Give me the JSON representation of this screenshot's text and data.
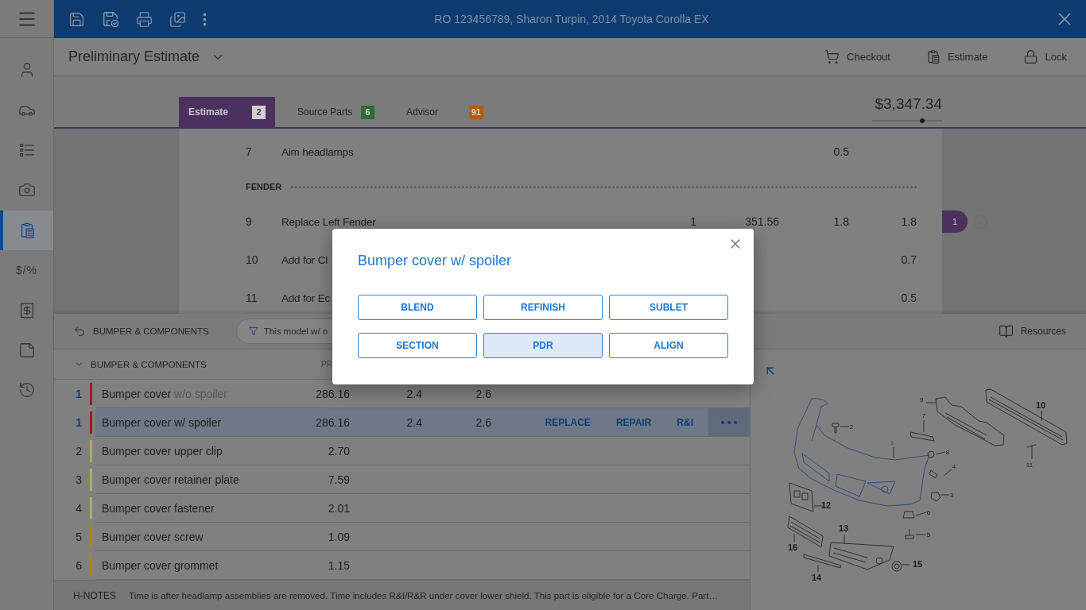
{
  "top_bar": {
    "title": "RO 123456789, Sharon Turpin, 2014 Toyota Corolla EX"
  },
  "sidebar": {
    "items": [
      {
        "selected": false
      },
      {
        "selected": false
      },
      {
        "selected": false
      },
      {
        "selected": false
      },
      {
        "selected": true
      },
      {
        "selected": false,
        "glyph": "$/%"
      },
      {
        "selected": false
      },
      {
        "selected": false
      },
      {
        "selected": false
      }
    ]
  },
  "header": {
    "title": "Preliminary Estimate",
    "actions": [
      "Checkout",
      "Estimate",
      "Lock"
    ]
  },
  "tabs": [
    {
      "label": "Estimate",
      "count": "2",
      "color": "#4a3160",
      "selected": true
    },
    {
      "label": "Source Parts",
      "count": "6",
      "color": "#2e6e31",
      "selected": false
    },
    {
      "label": "Advisor",
      "count": "91",
      "color": "#b35f00",
      "selected": false
    }
  ],
  "total": {
    "amount": "$3,347.34",
    "level": 0.72
  },
  "estimate_lines": [
    {
      "kind": "line",
      "number": "7",
      "description": "Aim headlamps",
      "column_5": "0.5"
    },
    {
      "kind": "section",
      "title": "FENDER"
    },
    {
      "kind": "line",
      "number": "9",
      "description": "Replace Left Fender",
      "column_3": "1",
      "column_4": "351.56",
      "column_5": "1.8",
      "column_6": "1.8",
      "badge": "1"
    },
    {
      "kind": "line",
      "number": "10",
      "description": "Add for Cl",
      "column_6": "0.7"
    },
    {
      "kind": "line",
      "number": "11",
      "description": "Add for Ec",
      "column_6": "0.5"
    }
  ],
  "parts_panel": {
    "breadcrumb": "BUMPER & COMPONENTS",
    "filter": "This model w/ o",
    "resources": "Resources",
    "group": {
      "title": "BUMPER & COMPONENTS",
      "expanded": true
    },
    "columns": [
      "PR"
    ],
    "rows": [
      {
        "quantity": "1",
        "emphasized": true,
        "color": "#9a1f1f",
        "name": "Bumper cover",
        "qualifier": "w/o spoiler",
        "column_2": "286.16",
        "column_3": "2.4",
        "column_4": "2.6",
        "selected": false
      },
      {
        "quantity": "1",
        "emphasized": true,
        "color": "#9a1f1f",
        "name": "Bumper cover w/ spoiler",
        "column_2": "286.16",
        "column_3": "2.4",
        "column_4": "2.6",
        "selected": true,
        "actions": [
          "REPLACE",
          "REPAIR",
          "R&I"
        ]
      },
      {
        "quantity": "2",
        "emphasized": false,
        "color": "#b3a95e",
        "name": "Bumper cover upper clip",
        "column_2": "2.70",
        "selected": false
      },
      {
        "quantity": "3",
        "emphasized": false,
        "color": "#b3a95e",
        "name": "Bumper cover retainer plate",
        "column_2": "7.59",
        "selected": false
      },
      {
        "quantity": "4",
        "emphasized": false,
        "color": "#b3a95e",
        "name": "Bumper cover fastener",
        "column_2": "2.01",
        "selected": false
      },
      {
        "quantity": "5",
        "emphasized": false,
        "color": "#a8870f",
        "name": "Bumper cover screw",
        "column_2": "1.09",
        "selected": false
      },
      {
        "quantity": "6",
        "emphasized": false,
        "color": "#a8870f",
        "name": "Bumper cover grommet",
        "column_2": "1.15",
        "selected": false
      }
    ],
    "notes": {
      "label": "H-NOTES",
      "text": "Time is after headlamp assemblies are removed. Time includes R&I/R&R under cover lower shield. This part is eligible for a Core Charge. Part…"
    }
  },
  "diagram": {
    "callouts": [
      {
        "label": "1",
        "highlighted": true
      },
      {
        "label": "2",
        "highlighted": false
      },
      {
        "label": "3",
        "highlighted": false
      },
      {
        "label": "4",
        "highlighted": false
      },
      {
        "label": "5",
        "highlighted": false
      },
      {
        "label": "6",
        "highlighted": false
      },
      {
        "label": "7",
        "highlighted": false
      },
      {
        "label": "8",
        "highlighted": false
      },
      {
        "label": "9",
        "highlighted": false
      },
      {
        "label": "10",
        "highlighted": false
      },
      {
        "label": "11",
        "highlighted": false
      },
      {
        "label": "12",
        "highlighted": false
      },
      {
        "label": "13",
        "highlighted": false
      },
      {
        "label": "14",
        "highlighted": false
      },
      {
        "label": "15",
        "highlighted": false
      },
      {
        "label": "16",
        "highlighted": false
      }
    ]
  },
  "dialog": {
    "title": "Bumper cover w/ spoiler",
    "options": [
      {
        "label": "BLEND",
        "selected": false
      },
      {
        "label": "REFINISH",
        "selected": false
      },
      {
        "label": "SUBLET",
        "selected": false
      },
      {
        "label": "SECTION",
        "selected": false
      },
      {
        "label": "PDR",
        "selected": true
      },
      {
        "label": "ALIGN",
        "selected": false
      }
    ]
  }
}
